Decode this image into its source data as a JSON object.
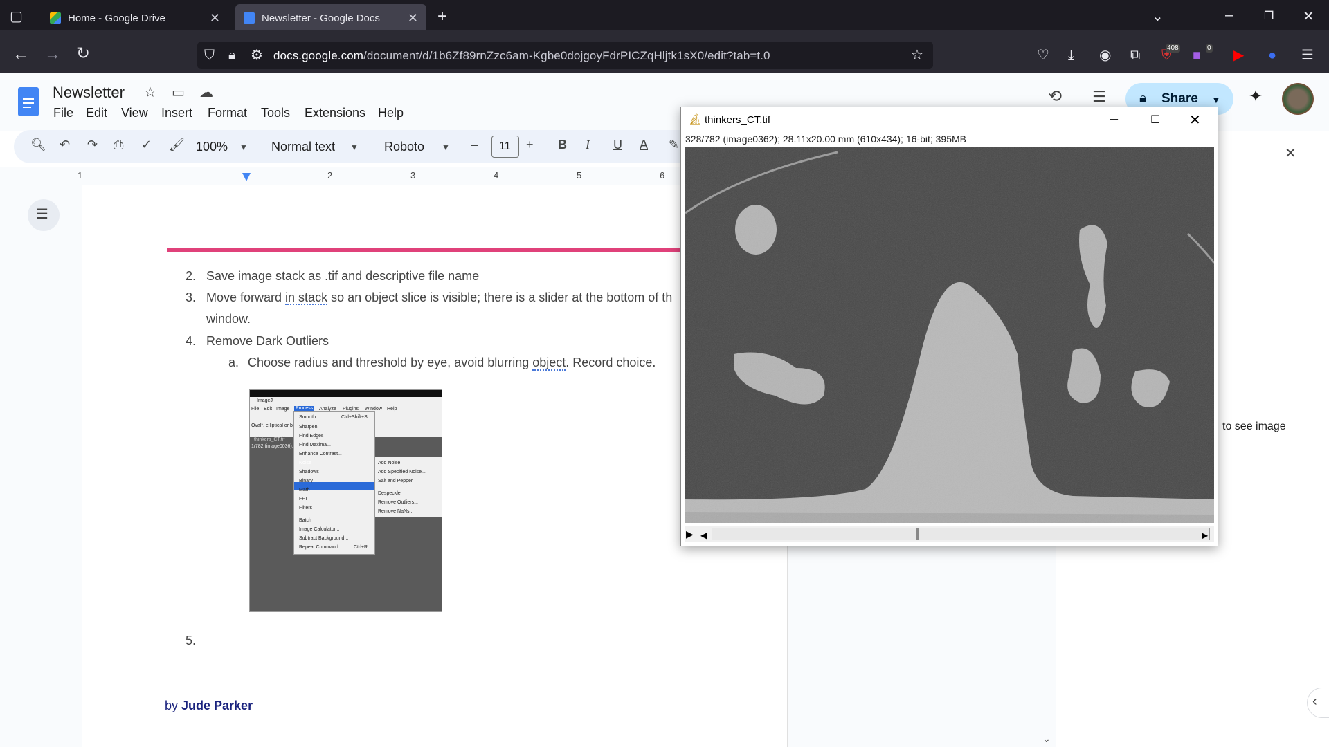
{
  "browser": {
    "tabs": [
      {
        "title": "Home - Google Drive",
        "active": false
      },
      {
        "title": "Newsletter - Google Docs",
        "active": true
      }
    ],
    "url_domain": "docs.google.com",
    "url_path": "/document/d/1b6Zf89rnZzc6am-Kgbe0dojgoyFdrPICZqHljtk1sX0/edit?tab=t.0",
    "badges": {
      "extension1": "408",
      "extension2": "0"
    }
  },
  "docs": {
    "title": "Newsletter",
    "menu": [
      "File",
      "Edit",
      "View",
      "Insert",
      "Format",
      "Tools",
      "Extensions",
      "Help"
    ],
    "toolbar": {
      "zoom": "100%",
      "style": "Normal text",
      "font": "Roboto",
      "font_size": "11"
    },
    "share_label": "Share",
    "ruler_numbers": [
      "1",
      "2",
      "3",
      "4",
      "5",
      "6"
    ],
    "content": {
      "item2_num": "2.",
      "item2": "Save image stack as .tif and descriptive file name",
      "item3_num": "3.",
      "item3_pre": "Move forward ",
      "item3_link": "in stack",
      "item3_post": " so an object slice is visible; there is a slider at the bottom of th",
      "item3_cont": "window.",
      "item4_num": "4.",
      "item4": "Remove Dark Outliers",
      "item4a_num": "a.",
      "item4a_pre": "Choose radius and threshold by eye, avoid blurring ",
      "item4a_squig": "object",
      "item4a_post": ". Record choice.",
      "item5_num": "5.",
      "byline_prefix": "by ",
      "byline_name": "Jude Parker"
    },
    "side_panel_text": "to see image"
  },
  "imagej": {
    "window_title": "thinkers_CT.tif",
    "info": "328/782 (image0362); 28.11x20.00 mm (610x434); 16-bit; 395MB"
  },
  "embedded_screenshot": {
    "menubar": [
      "File",
      "Edit",
      "Image",
      "Process",
      "Analyze",
      "Plugins",
      "Window",
      "Help"
    ],
    "process_menu": [
      "Smooth",
      "Sharpen",
      "Find Edges",
      "Find Maxima...",
      "Enhance Contrast...",
      "Noise",
      "Shadows",
      "Binary",
      "Math",
      "FFT",
      "Filters",
      "Batch",
      "Image Calculator...",
      "Subtract Background...",
      "Repeat Command"
    ],
    "smooth_shortcut": "Ctrl+Shift+S",
    "repeat_shortcut": "Ctrl+R",
    "noise_submenu": [
      "Add Noise",
      "Add Specified Noise...",
      "Salt and Pepper",
      "Despeckle",
      "Remove Outliers...",
      "Remove NaNs..."
    ],
    "title": "ImageJ",
    "status": "Oval*, elliptical or brush",
    "thumb_title": "thinkers_CT.tif",
    "thumb_info": "1/782 (image0036); 2..."
  },
  "colors": {
    "accent_pink": "#e0417a",
    "share_bg": "#c2e7ff",
    "docs_blue": "#4285f4"
  }
}
